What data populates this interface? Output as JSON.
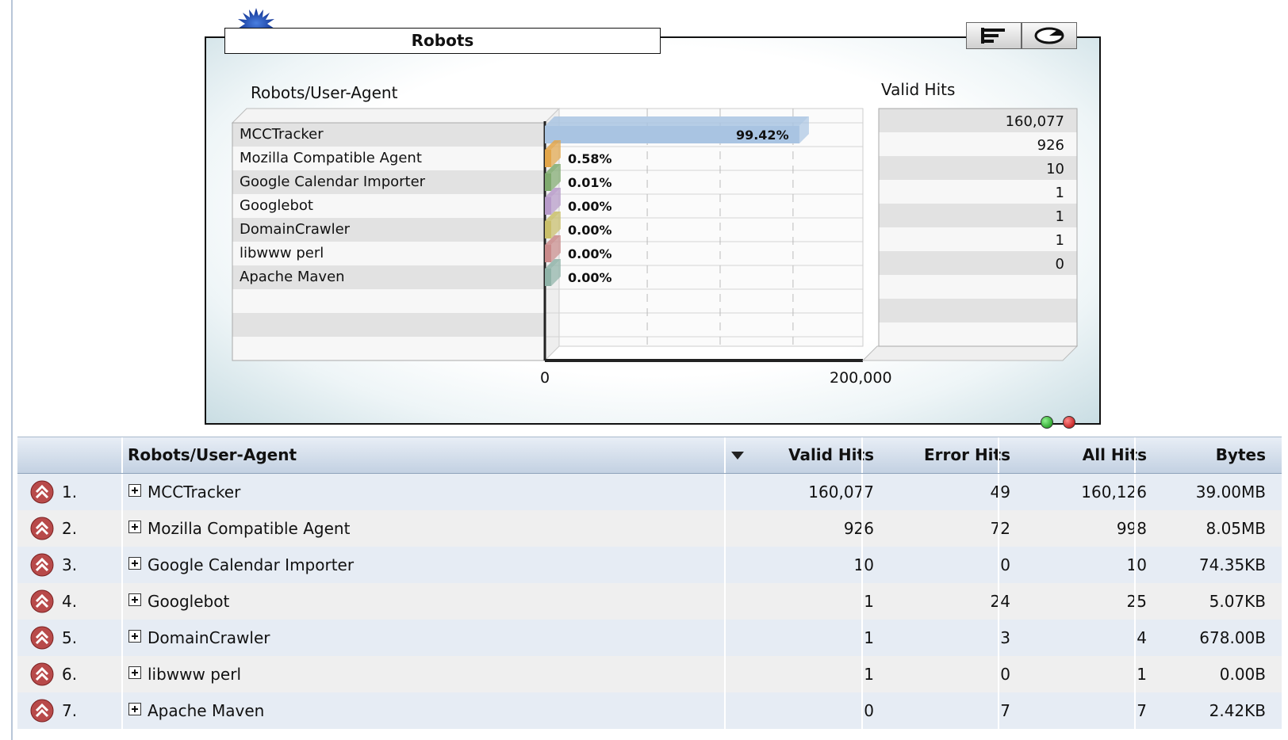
{
  "chart_data": {
    "type": "bar",
    "title": "Robots",
    "orientation": "horizontal",
    "category_header": "Robots/User-Agent",
    "value_header": "Valid Hits",
    "categories": [
      "MCCTracker",
      "Mozilla Compatible Agent",
      "Google Calendar Importer",
      "Googlebot",
      "DomainCrawler",
      "libwww perl",
      "Apache Maven"
    ],
    "values": [
      160077,
      926,
      10,
      1,
      1,
      1,
      0
    ],
    "value_labels": [
      "160,077",
      "926",
      "10",
      "1",
      "1",
      "1",
      "0"
    ],
    "percent_labels": [
      "99.42%",
      "0.58%",
      "0.01%",
      "0.00%",
      "0.00%",
      "0.00%",
      "0.00%"
    ],
    "colors": [
      "#a9c4e2",
      "#e3a64a",
      "#7faa6e",
      "#b79ac9",
      "#c9bf6a",
      "#c98a8a",
      "#8fb3a8"
    ],
    "xlim": [
      0,
      200000
    ],
    "x_tick_labels": [
      "0",
      "200,000"
    ],
    "grid": true
  },
  "table": {
    "headers": {
      "agent": "Robots/User-Agent",
      "valid": "Valid Hits",
      "error": "Error Hits",
      "all": "All Hits",
      "bytes": "Bytes"
    },
    "rows": [
      {
        "rank": "1.",
        "agent": "MCCTracker",
        "valid": "160,077",
        "error": "49",
        "all": "160,126",
        "bytes": "39.00MB"
      },
      {
        "rank": "2.",
        "agent": "Mozilla Compatible Agent",
        "valid": "926",
        "error": "72",
        "all": "998",
        "bytes": "8.05MB"
      },
      {
        "rank": "3.",
        "agent": "Google Calendar Importer",
        "valid": "10",
        "error": "0",
        "all": "10",
        "bytes": "74.35KB"
      },
      {
        "rank": "4.",
        "agent": "Googlebot",
        "valid": "1",
        "error": "24",
        "all": "25",
        "bytes": "5.07KB"
      },
      {
        "rank": "5.",
        "agent": "DomainCrawler",
        "valid": "1",
        "error": "3",
        "all": "4",
        "bytes": "678.00B"
      },
      {
        "rank": "6.",
        "agent": "libwww perl",
        "valid": "1",
        "error": "0",
        "all": "1",
        "bytes": "0.00B"
      },
      {
        "rank": "7.",
        "agent": "Apache Maven",
        "valid": "0",
        "error": "7",
        "all": "7",
        "bytes": "2.42KB"
      }
    ]
  },
  "icons": {
    "chart_type": "bar-chart-icon",
    "pie_toggle": "pie-chart-icon",
    "sort": "sort-descending-icon",
    "rank": "drill-up-icon",
    "expand": "expand-plus-icon",
    "status_ok": "green-status-icon",
    "status_err": "red-status-icon"
  }
}
